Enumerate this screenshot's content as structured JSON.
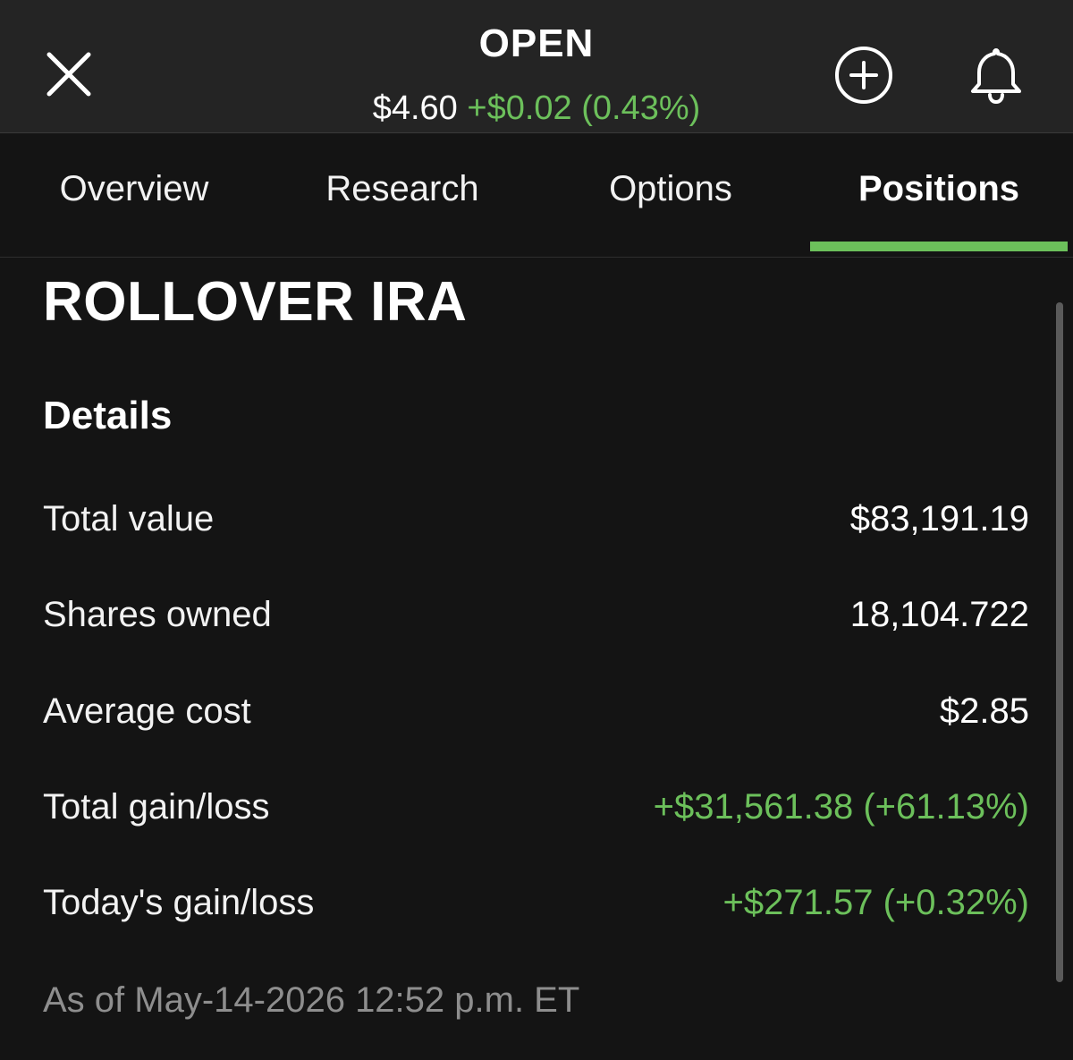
{
  "header": {
    "ticker": "OPEN",
    "price": "$4.60",
    "change": "+$0.02 (0.43%)"
  },
  "tabs": [
    {
      "label": "Overview"
    },
    {
      "label": "Research"
    },
    {
      "label": "Options"
    },
    {
      "label": "Positions",
      "active": true
    }
  ],
  "account": {
    "title": "ROLLOVER IRA",
    "section_title": "Details",
    "rows": [
      {
        "label": "Total value",
        "value": "$83,191.19"
      },
      {
        "label": "Shares owned",
        "value": "18,104.722"
      },
      {
        "label": "Average cost",
        "value": "$2.85"
      },
      {
        "label": "Total gain/loss",
        "value": "+$31,561.38 (+61.13%)",
        "positive": true
      },
      {
        "label": "Today's gain/loss",
        "value": "+$271.57 (+0.32%)",
        "positive": true
      }
    ],
    "as_of": "As of May-14-2026 12:52 p.m. ET"
  },
  "colors": {
    "accent_green": "#6cc05b",
    "background": "#141414",
    "header_background": "#242424",
    "muted_text": "#8e8e8e"
  },
  "icons": {
    "close": "close-icon",
    "add": "plus-circle-icon",
    "alerts": "bell-icon"
  }
}
